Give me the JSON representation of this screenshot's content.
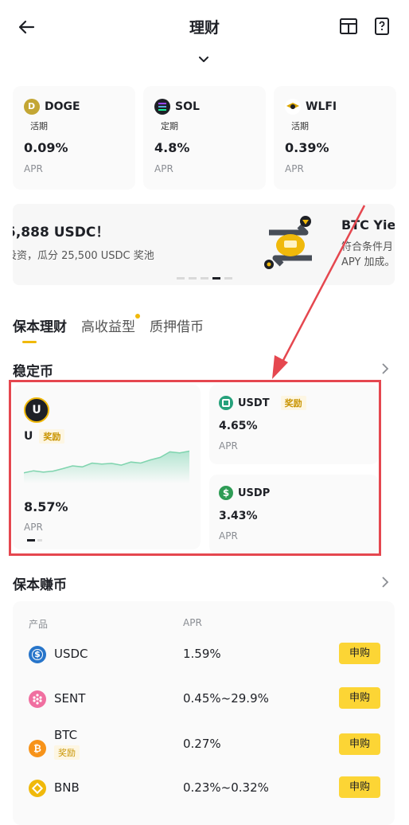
{
  "header": {
    "title": "理财"
  },
  "coins": [
    {
      "name": "DOGE",
      "type": "活期",
      "rate": "0.09%",
      "apr": "APR",
      "color": "#c3a634"
    },
    {
      "name": "SOL",
      "type": "定期",
      "rate": "4.8%",
      "apr": "APR",
      "color": "#1e2026"
    },
    {
      "name": "WLFI",
      "type": "活期",
      "rate": "0.39%",
      "apr": "APR",
      "color": "#1e2026"
    }
  ],
  "banner": {
    "title": "5,888 USDC！",
    "sub": "投资，瓜分 25,500 USDC 奖池",
    "right_title": "BTC Yie",
    "right_sub1": "符合条件月",
    "right_sub2": "APY 加成。"
  },
  "tabs": [
    "保本理财",
    "高收益型",
    "质押借币"
  ],
  "stable": {
    "title": "稳定币",
    "u": {
      "name": "U",
      "tag": "奖励",
      "rate": "8.57%",
      "apr": "APR",
      "sparkline": [
        0.3,
        0.36,
        0.32,
        0.35,
        0.42,
        0.5,
        0.47,
        0.58,
        0.55,
        0.57,
        0.52,
        0.61,
        0.58,
        0.67,
        0.74,
        0.9,
        0.87,
        0.92
      ]
    },
    "cards": [
      {
        "name": "USDT",
        "tag": "奖励",
        "rate": "4.65%",
        "apr": "APR",
        "color": "#26a17b"
      },
      {
        "name": "USDP",
        "tag": "",
        "rate": "3.43%",
        "apr": "APR",
        "color": "#2e9c55"
      }
    ]
  },
  "earn": {
    "title": "保本赚币",
    "col_product": "产品",
    "col_apr": "APR",
    "buy_label": "申购",
    "rows": [
      {
        "name": "USDC",
        "rate": "1.59%",
        "tag": "",
        "color": "#2775ca"
      },
      {
        "name": "SENT",
        "rate": "0.45%~29.9%",
        "tag": "",
        "color": "#f06fa0"
      },
      {
        "name": "BTC",
        "rate": "0.27%",
        "tag": "奖励",
        "color": "#f7931a"
      },
      {
        "name": "BNB",
        "rate": "0.23%~0.32%",
        "tag": "",
        "color": "#f0b90b"
      }
    ]
  }
}
